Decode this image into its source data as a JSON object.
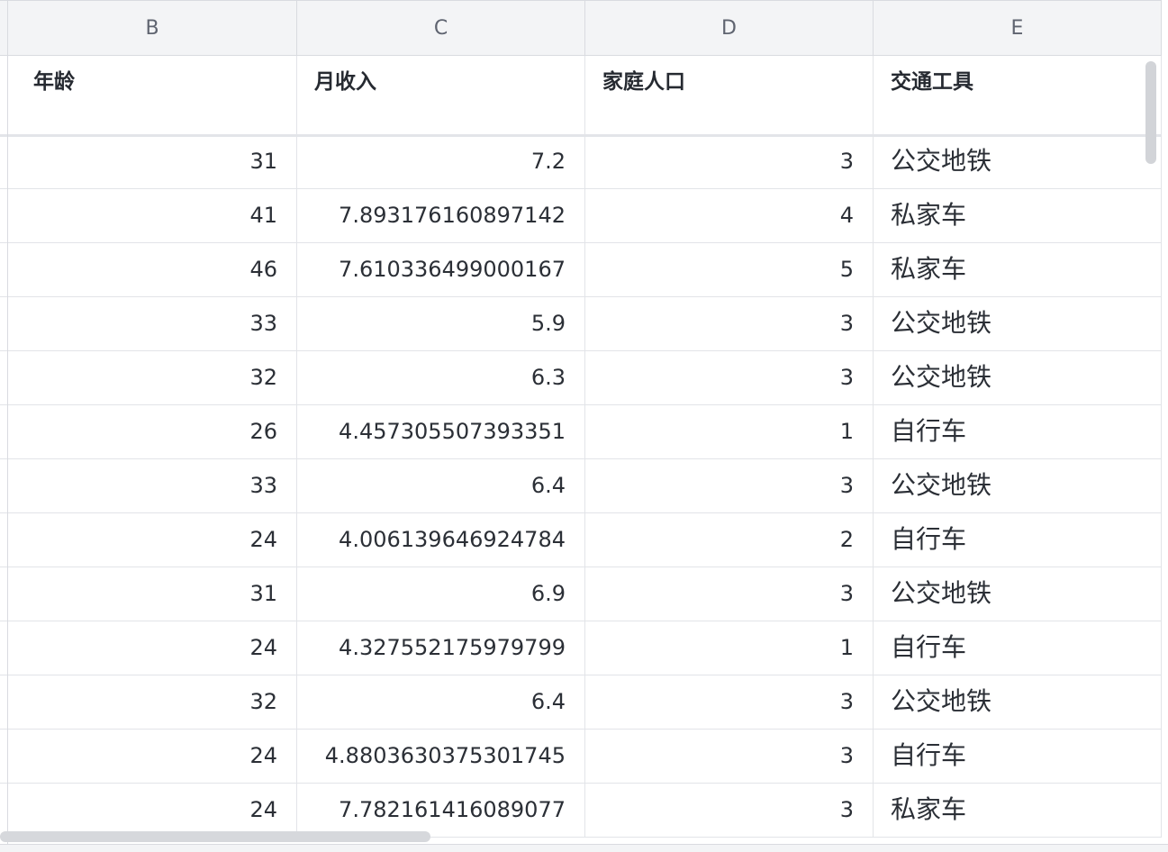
{
  "columns": [
    {
      "letter": "B",
      "header": "年龄"
    },
    {
      "letter": "C",
      "header": "月收入"
    },
    {
      "letter": "D",
      "header": "家庭人口"
    },
    {
      "letter": "E",
      "header": "交通工具"
    }
  ],
  "rows": [
    {
      "age": "31",
      "income": "7.2",
      "family": "3",
      "transport": "公交地铁"
    },
    {
      "age": "41",
      "income": "7.893176160897142",
      "family": "4",
      "transport": "私家车"
    },
    {
      "age": "46",
      "income": "7.610336499000167",
      "family": "5",
      "transport": "私家车"
    },
    {
      "age": "33",
      "income": "5.9",
      "family": "3",
      "transport": "公交地铁"
    },
    {
      "age": "32",
      "income": "6.3",
      "family": "3",
      "transport": "公交地铁"
    },
    {
      "age": "26",
      "income": "4.457305507393351",
      "family": "1",
      "transport": "自行车"
    },
    {
      "age": "33",
      "income": "6.4",
      "family": "3",
      "transport": "公交地铁"
    },
    {
      "age": "24",
      "income": "4.006139646924784",
      "family": "2",
      "transport": "自行车"
    },
    {
      "age": "31",
      "income": "6.9",
      "family": "3",
      "transport": "公交地铁"
    },
    {
      "age": "24",
      "income": "4.327552175979799",
      "family": "1",
      "transport": "自行车"
    },
    {
      "age": "32",
      "income": "6.4",
      "family": "3",
      "transport": "公交地铁"
    },
    {
      "age": "24",
      "income": "4.8803630375301745",
      "family": "3",
      "transport": "自行车"
    },
    {
      "age": "24",
      "income": "7.782161416089077",
      "family": "3",
      "transport": "私家车"
    }
  ]
}
